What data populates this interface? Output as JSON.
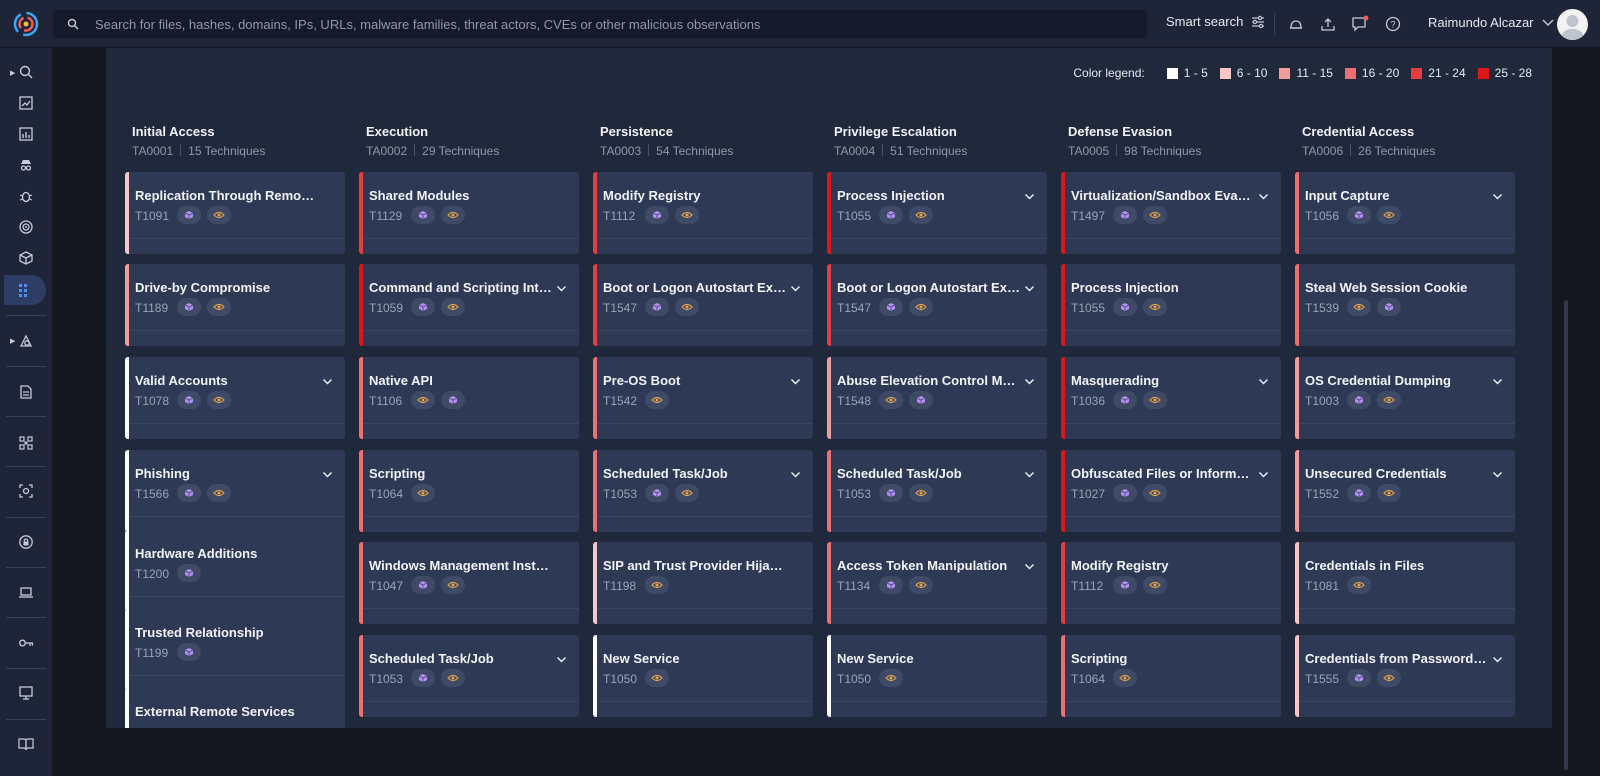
{
  "search": {
    "placeholder": "Search for files, hashes, domains, IPs, URLs, malware families, threat actors, CVEs or other malicious observations"
  },
  "topbar": {
    "smart_search": "Smart search",
    "user_name": "Raimundo Alcazar"
  },
  "legend": {
    "title": "Color legend:",
    "items": [
      {
        "label": "1 - 5",
        "color": "#ffffff"
      },
      {
        "label": "6 - 10",
        "color": "#f7c7c7"
      },
      {
        "label": "11 - 15",
        "color": "#f29b9b"
      },
      {
        "label": "16 - 20",
        "color": "#ee6f6f"
      },
      {
        "label": "21 - 24",
        "color": "#e63e3e"
      },
      {
        "label": "25 - 28",
        "color": "#dd1717"
      }
    ]
  },
  "tactics": [
    {
      "title": "Initial Access",
      "id": "TA0001",
      "count": "15 Techniques",
      "cards": [
        {
          "name": "Replication Through Removable M...",
          "id": "T1091",
          "color": "#f7c7c7",
          "chevron": false,
          "pills": [
            "cube",
            "eye"
          ]
        },
        {
          "name": "Drive-by Compromise",
          "id": "T1189",
          "color": "#f29b9b",
          "chevron": false,
          "pills": [
            "cube",
            "eye"
          ]
        },
        {
          "name": "Valid Accounts",
          "id": "T1078",
          "color": "#ffffff",
          "chevron": true,
          "pills": [
            "cube",
            "eye"
          ]
        },
        {
          "name": "Phishing",
          "id": "T1566",
          "color": "#ffffff",
          "chevron": true,
          "pills": [
            "cube",
            "eye"
          ]
        },
        {
          "name": "Hardware Additions",
          "id": "T1200",
          "color": "#ffffff",
          "chevron": false,
          "pills": [
            "cube"
          ]
        },
        {
          "name": "Trusted Relationship",
          "id": "T1199",
          "color": "#ffffff",
          "chevron": false,
          "pills": [
            "cube"
          ]
        },
        {
          "name": "External Remote Services",
          "id": "",
          "color": "#ffffff",
          "chevron": false,
          "pills": []
        }
      ]
    },
    {
      "title": "Execution",
      "id": "TA0002",
      "count": "29 Techniques",
      "cards": [
        {
          "name": "Shared Modules",
          "id": "T1129",
          "color": "#e63e3e",
          "chevron": false,
          "pills": [
            "cube",
            "eye"
          ]
        },
        {
          "name": "Command and Scripting Inter...",
          "id": "T1059",
          "color": "#dd1717",
          "chevron": true,
          "pills": [
            "cube",
            "eye"
          ]
        },
        {
          "name": "Native API",
          "id": "T1106",
          "color": "#ee6f6f",
          "chevron": false,
          "pills": [
            "eye",
            "cube"
          ]
        },
        {
          "name": "Scripting",
          "id": "T1064",
          "color": "#ee6f6f",
          "chevron": false,
          "pills": [
            "eye"
          ]
        },
        {
          "name": "Windows Management Instrument...",
          "id": "T1047",
          "color": "#ee6f6f",
          "chevron": false,
          "pills": [
            "cube",
            "eye"
          ]
        },
        {
          "name": "Scheduled Task/Job",
          "id": "T1053",
          "color": "#ee6f6f",
          "chevron": true,
          "pills": [
            "cube",
            "eye"
          ]
        }
      ]
    },
    {
      "title": "Persistence",
      "id": "TA0003",
      "count": "54 Techniques",
      "cards": [
        {
          "name": "Modify Registry",
          "id": "T1112",
          "color": "#e63e3e",
          "chevron": false,
          "pills": [
            "cube",
            "eye"
          ]
        },
        {
          "name": "Boot or Logon Autostart Exec...",
          "id": "T1547",
          "color": "#e63e3e",
          "chevron": true,
          "pills": [
            "cube",
            "eye"
          ]
        },
        {
          "name": "Pre-OS Boot",
          "id": "T1542",
          "color": "#ee6f6f",
          "chevron": true,
          "pills": [
            "eye"
          ]
        },
        {
          "name": "Scheduled Task/Job",
          "id": "T1053",
          "color": "#ee6f6f",
          "chevron": true,
          "pills": [
            "cube",
            "eye"
          ]
        },
        {
          "name": "SIP and Trust Provider Hijacking",
          "id": "T1198",
          "color": "#f7c7c7",
          "chevron": false,
          "pills": [
            "eye"
          ]
        },
        {
          "name": "New Service",
          "id": "T1050",
          "color": "#ffffff",
          "chevron": false,
          "pills": [
            "eye"
          ]
        }
      ]
    },
    {
      "title": "Privilege Escalation",
      "id": "TA0004",
      "count": "51 Techniques",
      "cards": [
        {
          "name": "Process Injection",
          "id": "T1055",
          "color": "#dd1717",
          "chevron": true,
          "pills": [
            "cube",
            "eye"
          ]
        },
        {
          "name": "Boot or Logon Autostart Exec...",
          "id": "T1547",
          "color": "#e63e3e",
          "chevron": true,
          "pills": [
            "cube",
            "eye"
          ]
        },
        {
          "name": "Abuse Elevation Control Mech...",
          "id": "T1548",
          "color": "#f29b9b",
          "chevron": true,
          "pills": [
            "eye",
            "cube"
          ]
        },
        {
          "name": "Scheduled Task/Job",
          "id": "T1053",
          "color": "#ee6f6f",
          "chevron": true,
          "pills": [
            "cube",
            "eye"
          ]
        },
        {
          "name": "Access Token Manipulation",
          "id": "T1134",
          "color": "#ee6f6f",
          "chevron": true,
          "pills": [
            "cube",
            "eye"
          ]
        },
        {
          "name": "New Service",
          "id": "T1050",
          "color": "#ffffff",
          "chevron": false,
          "pills": [
            "eye"
          ]
        }
      ]
    },
    {
      "title": "Defense Evasion",
      "id": "TA0005",
      "count": "98 Techniques",
      "cards": [
        {
          "name": "Virtualization/Sandbox Evasion",
          "id": "T1497",
          "color": "#dd1717",
          "chevron": true,
          "pills": [
            "cube",
            "eye"
          ]
        },
        {
          "name": "Process Injection",
          "id": "T1055",
          "color": "#dd1717",
          "chevron": false,
          "pills": [
            "cube",
            "eye"
          ]
        },
        {
          "name": "Masquerading",
          "id": "T1036",
          "color": "#dd1717",
          "chevron": true,
          "pills": [
            "cube",
            "eye"
          ]
        },
        {
          "name": "Obfuscated Files or Information",
          "id": "T1027",
          "color": "#dd1717",
          "chevron": true,
          "pills": [
            "cube",
            "eye"
          ]
        },
        {
          "name": "Modify Registry",
          "id": "T1112",
          "color": "#e63e3e",
          "chevron": false,
          "pills": [
            "cube",
            "eye"
          ]
        },
        {
          "name": "Scripting",
          "id": "T1064",
          "color": "#ee6f6f",
          "chevron": false,
          "pills": [
            "eye"
          ]
        }
      ]
    },
    {
      "title": "Credential Access",
      "id": "TA0006",
      "count": "26 Techniques",
      "cards": [
        {
          "name": "Input Capture",
          "id": "T1056",
          "color": "#ee6f6f",
          "chevron": true,
          "pills": [
            "cube",
            "eye"
          ]
        },
        {
          "name": "Steal Web Session Cookie",
          "id": "T1539",
          "color": "#ee6f6f",
          "chevron": false,
          "pills": [
            "eye",
            "cube"
          ]
        },
        {
          "name": "OS Credential Dumping",
          "id": "T1003",
          "color": "#f29b9b",
          "chevron": true,
          "pills": [
            "cube",
            "eye"
          ]
        },
        {
          "name": "Unsecured Credentials",
          "id": "T1552",
          "color": "#f29b9b",
          "chevron": true,
          "pills": [
            "cube",
            "eye"
          ]
        },
        {
          "name": "Credentials in Files",
          "id": "T1081",
          "color": "#f7c7c7",
          "chevron": false,
          "pills": [
            "eye"
          ]
        },
        {
          "name": "Credentials from Password St...",
          "id": "T1555",
          "color": "#f7c7c7",
          "chevron": true,
          "pills": [
            "cube",
            "eye"
          ]
        }
      ]
    }
  ]
}
